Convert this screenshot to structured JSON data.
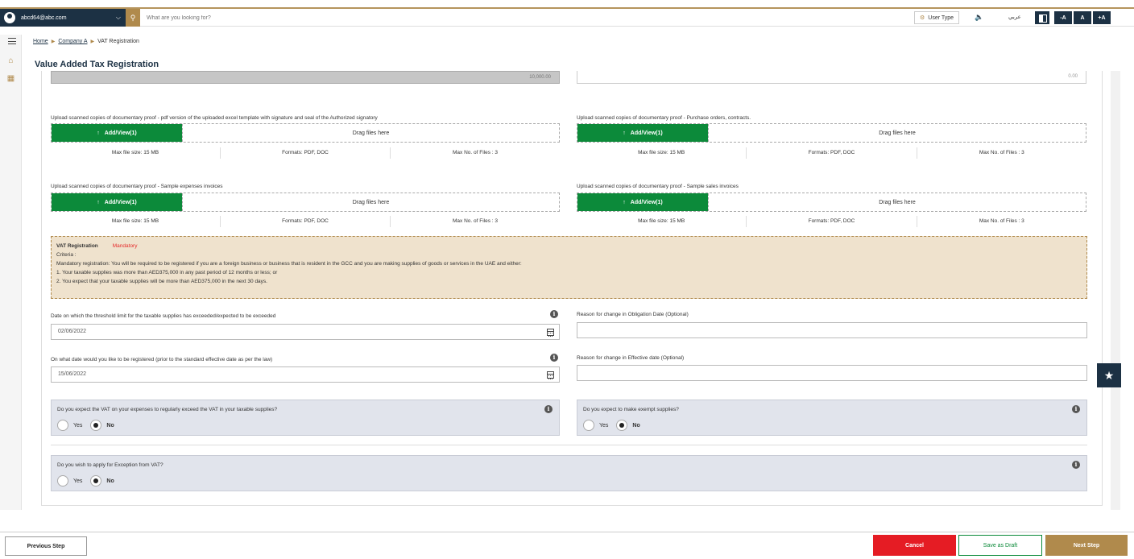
{
  "header": {
    "email": "abcd64@abc.com",
    "search_placeholder": "What are you looking for?",
    "user_type": "User Type",
    "language": "عربي",
    "font_decrease": "-A",
    "font_normal": "A",
    "font_increase": "+A"
  },
  "breadcrumb": {
    "home": "Home",
    "company": "Company A",
    "current": "VAT Registration"
  },
  "page_title": "Value Added Tax Registration",
  "prev_fields": {
    "left_value": "10,000.00",
    "right_value": "0.00"
  },
  "uploads": [
    {
      "label": "Upload scanned copies of documentary proof - pdf version of the uploaded excel template with signature and seal of the Authorized signatory",
      "add": "Add/View(1)",
      "drag": "Drag files here",
      "size": "Max file size: 15 MB",
      "formats": "Formats: PDF, DOC",
      "count": "Max No. of Files : 3"
    },
    {
      "label": "Upload scanned copies of documentary proof - Purchase orders, contracts.",
      "add": "Add/View(1)",
      "drag": "Drag files here",
      "size": "Max file size: 15 MB",
      "formats": "Formats: PDF, DOC",
      "count": "Max No. of Files : 3"
    },
    {
      "label": "Upload scanned copies of documentary proof - Sample expenses invoices",
      "add": "Add/View(1)",
      "drag": "Drag files here",
      "size": "Max file size: 15 MB",
      "formats": "Formats: PDF, DOC",
      "count": "Max No. of Files : 3"
    },
    {
      "label": "Upload scanned copies of documentary proof - Sample sales invoices",
      "add": "Add/View(1)",
      "drag": "Drag files here",
      "size": "Max file size: 15 MB",
      "formats": "Formats: PDF, DOC",
      "count": "Max No. of Files : 3"
    }
  ],
  "criteria": {
    "title": "VAT Registration",
    "mandatory": "Mandatory",
    "criteria_label": "Criteria :",
    "line1": "Mandatory registration: You will be required to be registered if you are a foreign business or business that is resident in the GCC and you are making supplies of goods or services in the UAE and either:",
    "line2": "1. Your taxable supplies was more than AED375,000 in any past period of 12 months or less; or",
    "line3": "2. You expect that your taxable supplies will be more than AED375,000 in the next 30 days."
  },
  "dates": {
    "threshold_label": "Date on which the threshold limit for the taxable supplies has exceeded/expected to be exceeded",
    "threshold_value": "02/06/2022",
    "obligation_reason_label": "Reason for change in Obligation Date (Optional)",
    "obligation_reason_value": "",
    "registered_label": "On what date would you like to be registered (prior to the standard effective date as per the law)",
    "registered_value": "15/06/2022",
    "effective_reason_label": "Reason for change in Effective date (Optional)",
    "effective_reason_value": ""
  },
  "questions": {
    "q1": "Do you expect the VAT on your expenses to regularly exceed the VAT in your taxable supplies?",
    "q2": "Do you expect to make exempt supplies?",
    "q3": "Do you wish to apply for Exception from VAT?",
    "yes": "Yes",
    "no": "No"
  },
  "footer": {
    "previous": "Previous Step",
    "cancel": "Cancel",
    "draft": "Save as Draft",
    "next": "Next Step"
  },
  "icons": {
    "star": "star-icon",
    "info": "info-icon",
    "calendar": "calendar-icon",
    "upload": "upload-icon"
  }
}
